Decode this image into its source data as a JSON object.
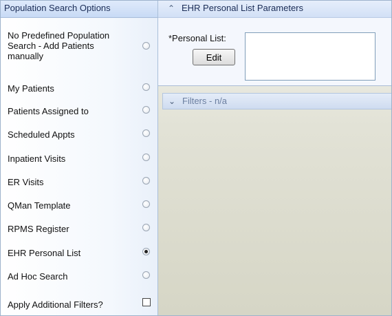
{
  "left_panel": {
    "title": "Population Search Options",
    "options": [
      {
        "label": "No Predefined Population Search - Add Patients manually",
        "selected": false
      },
      {
        "label": "My Patients",
        "selected": false
      },
      {
        "label": "Patients Assigned to",
        "selected": false
      },
      {
        "label": "Scheduled Appts",
        "selected": false
      },
      {
        "label": "Inpatient Visits",
        "selected": false
      },
      {
        "label": "ER Visits",
        "selected": false
      },
      {
        "label": "QMan Template",
        "selected": false
      },
      {
        "label": "RPMS Register",
        "selected": false
      },
      {
        "label": "EHR Personal List",
        "selected": true
      },
      {
        "label": "Ad Hoc Search",
        "selected": false
      }
    ],
    "additional_filters": {
      "label": "Apply Additional Filters?",
      "checked": false
    }
  },
  "params_panel": {
    "title": "EHR Personal List Parameters",
    "collapse_icon": "double-chevron-up-icon",
    "personal_list_label": "*Personal List:",
    "edit_button": "Edit",
    "personal_list_value": ""
  },
  "filters_panel": {
    "title": "Filters - n/a",
    "expand_icon": "double-chevron-down-icon"
  }
}
